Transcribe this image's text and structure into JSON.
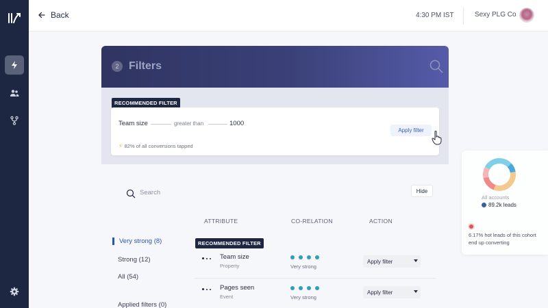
{
  "topbar": {
    "back_label": "Back",
    "time": "4:30 PM IST",
    "company": "Sexy PLG Co"
  },
  "filters": {
    "step_number": "2",
    "title": "Filters"
  },
  "recommended": {
    "badge": "RECOMMENDED FILTER",
    "attribute": "Team size",
    "operator": "greater than",
    "value": "1000",
    "apply_label": "Apply filter",
    "stat": "82% of all conversions tapped"
  },
  "search": {
    "placeholder": "Search",
    "hide_label": "Hide"
  },
  "columns": {
    "attribute": "ATTRIBUTE",
    "correlation": "CO-RELATION",
    "action": "ACTION"
  },
  "strength_tabs": [
    {
      "label": "Very strong (8)"
    },
    {
      "label": "Strong (12)"
    },
    {
      "label": "All (54)"
    },
    {
      "label": "Applied filters (0)"
    }
  ],
  "rows_badge": "RECOMMENDED FILTER",
  "rows": [
    {
      "name": "Team size",
      "type": "Property",
      "correlation": "Very strong",
      "action": "Apply filter"
    },
    {
      "name": "Pages seen",
      "type": "Event",
      "correlation": "Very strong",
      "action": "Apply filter"
    }
  ],
  "summary_card": {
    "label": "All accounts",
    "leads": "89.2k leads",
    "hot_text": "6.17% hot leads of this cohort end up converting"
  },
  "colors": {
    "sidebar": "#1e2742",
    "accent_blue": "#2a55b8",
    "correlation_dot": "#2f9fb6",
    "header_gradient_start": "#2f3461",
    "header_gradient_end": "#555ba8"
  }
}
